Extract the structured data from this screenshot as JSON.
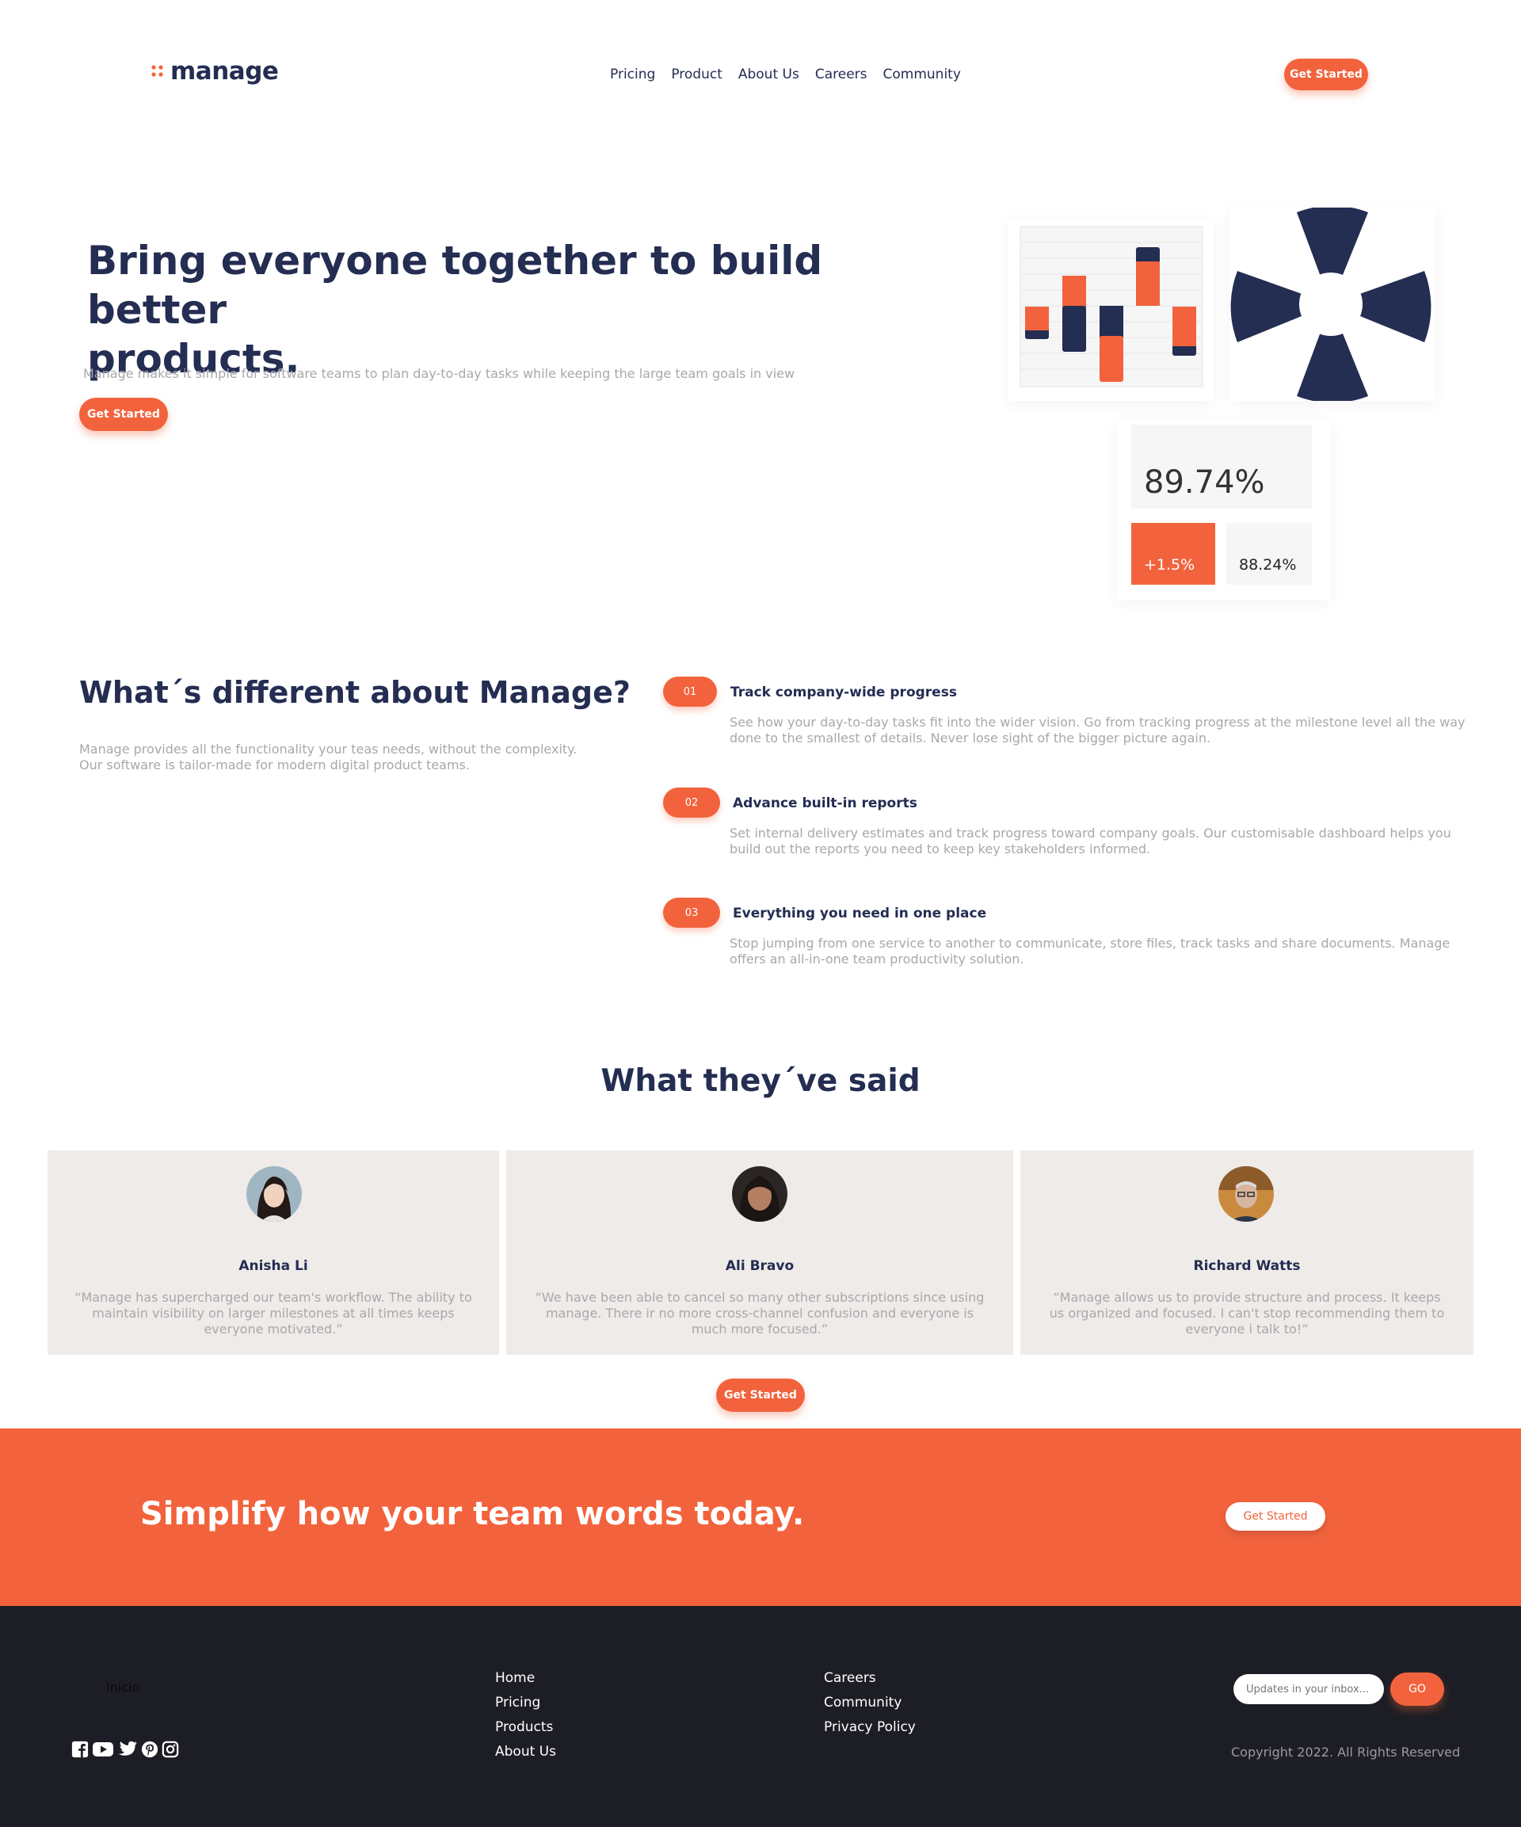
{
  "brand": {
    "name": "manage"
  },
  "nav": {
    "items": [
      "Pricing",
      "Product",
      "About Us",
      "Careers",
      "Community"
    ]
  },
  "header": {
    "cta_label": "Get Started"
  },
  "hero": {
    "title_line1": "Bring everyone together to build better",
    "title_line2": "products.",
    "subtitle": "Manage makes it simple for software teams to plan day-to-day tasks while keeping the large team goals in view",
    "cta_label": "Get Started"
  },
  "stats": {
    "main": "89.74%",
    "delta": "+1.5%",
    "secondary": "88.24%"
  },
  "different": {
    "title": "What´s different about Manage?",
    "text": "Manage provides all the functionality your teas needs, without the complexity. Our software is tailor-made for modern digital product teams.",
    "features": [
      {
        "num": "01",
        "title": "Track company-wide progress",
        "text": "See how your day-to-day tasks fit into the wider vision. Go from tracking progress at the milestone level all the way done to the smallest of details. Never lose sight of the bigger picture again."
      },
      {
        "num": "02",
        "title": "Advance built-in reports",
        "text": "Set internal delivery estimates and track progress toward company goals. Our customisable dashboard helps you build out the reports you need to keep key stakeholders informed."
      },
      {
        "num": "03",
        "title": "Everything you need in one place",
        "text": "Stop jumping from one service to another to communicate, store files, track tasks and share documents. Manage offers an all-in-one team productivity solution."
      }
    ]
  },
  "testimonials": {
    "title": "What they´ve said",
    "items": [
      {
        "name": "Anisha Li",
        "quote": "“Manage has supercharged our team's workflow. The ability to maintain visibility on larger milestones at all times keeps everyone motivated.”"
      },
      {
        "name": "Ali Bravo",
        "quote": "“We have been able to cancel so many other subscriptions since using manage. There ir no more cross-channel confusion and everyone is much more focused.”"
      },
      {
        "name": "Richard Watts",
        "quote": "“Manage allows us to provide structure and process. It keeps us organized and focused. I can't stop recommending them to everyone i talk to!”"
      }
    ],
    "cta_label": "Get Started"
  },
  "banner": {
    "title": "Simplify how your team words today.",
    "cta_label": "Get Started"
  },
  "footer": {
    "logo_alt": "Inicio",
    "col1": [
      "Home",
      "Pricing",
      "Products",
      "About Us"
    ],
    "col2": [
      "Careers",
      "Community",
      "Privacy Policy"
    ],
    "newsletter": {
      "placeholder": "Updates in your inbox...",
      "button_label": "GO"
    },
    "copyright": "Copyright 2022. All Rights Reserved",
    "social_icons": [
      "facebook-icon",
      "youtube-icon",
      "twitter-icon",
      "pinterest-icon",
      "instagram-icon"
    ]
  },
  "colors": {
    "accent": "#f2633d",
    "navy": "#242d52",
    "footer_bg": "#1d1e25",
    "card_bg": "#eeebe8"
  }
}
